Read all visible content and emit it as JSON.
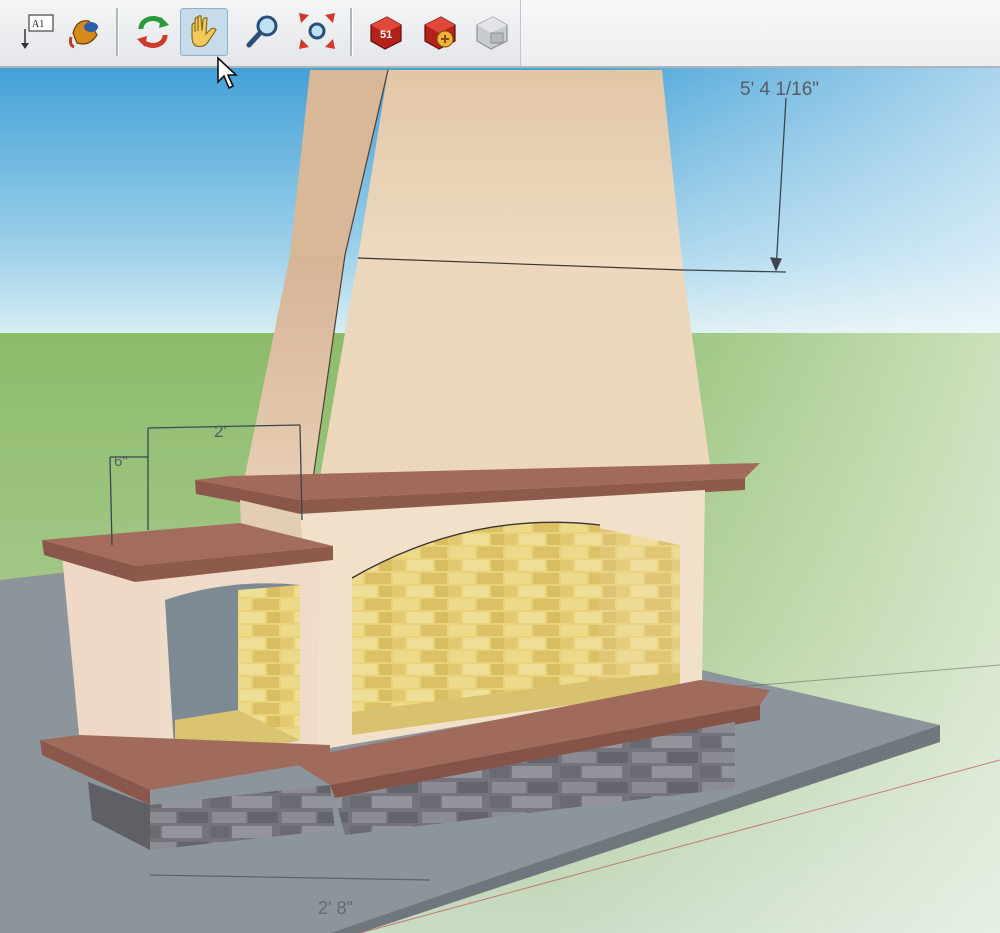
{
  "app": {
    "name": "SketchUp-style 3D modeling viewport"
  },
  "toolbar": {
    "tools": [
      {
        "name": "text-tool",
        "icon": "text-label-icon",
        "label": "A1"
      },
      {
        "name": "paint-bucket-tool",
        "icon": "paint-bucket-icon"
      },
      {
        "name": "orbit-tool",
        "icon": "orbit-icon"
      },
      {
        "name": "pan-tool",
        "icon": "pan-hand-icon",
        "active": true
      },
      {
        "name": "zoom-tool",
        "icon": "zoom-magnifier-icon"
      },
      {
        "name": "zoom-extents-tool",
        "icon": "zoom-extents-icon"
      },
      {
        "name": "get-models-tool",
        "icon": "3d-warehouse-icon"
      },
      {
        "name": "share-model-tool",
        "icon": "share-model-icon"
      },
      {
        "name": "extension-tool",
        "icon": "extension-disabled-icon",
        "disabled": true
      }
    ]
  },
  "dimensions": {
    "height_label": "5' 4 1/16\"",
    "shelf_width_label": "2'",
    "small_offset_label": "6\"",
    "base_length_label": "2' 8\""
  },
  "colors": {
    "sky_top": "#4aa7d8",
    "sky_bottom": "#d5edf3",
    "ground": "#8fbb6c",
    "slab": "#8b939a",
    "stucco": "#e6cfb7",
    "mantel": "#99655a",
    "firebox_brick": "#e7cf73",
    "stone_base": "#6f6f77",
    "accent_active": "#c7dcea"
  }
}
